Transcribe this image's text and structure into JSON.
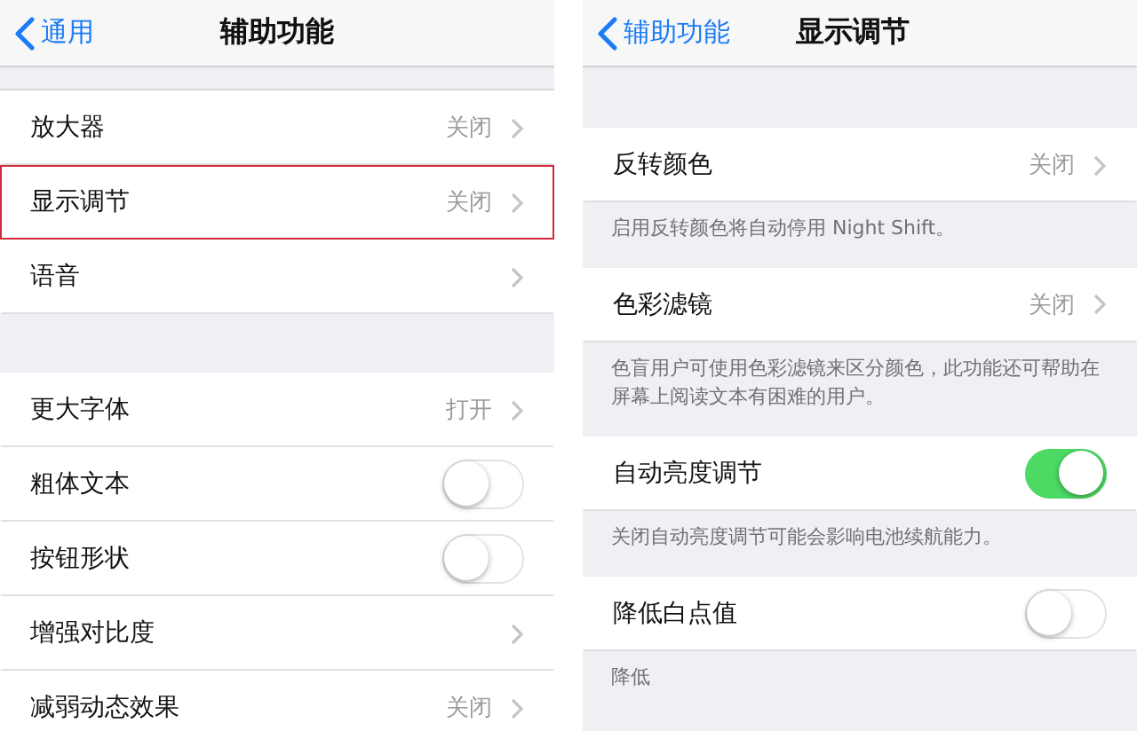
{
  "panels": [
    {
      "back": "通用",
      "title": "辅助功能",
      "groups": [
        {
          "rows": [
            {
              "kind": "disclosure",
              "label": "放大器",
              "value": "关闭",
              "highlighted": false
            },
            {
              "kind": "disclosure",
              "label": "显示调节",
              "value": "关闭",
              "highlighted": true
            },
            {
              "kind": "disclosure",
              "label": "语音",
              "highlighted": false
            }
          ]
        },
        {
          "rows": [
            {
              "kind": "disclosure",
              "label": "更大字体",
              "value": "打开",
              "highlighted": false
            },
            {
              "kind": "toggle",
              "label": "粗体文本",
              "on": false,
              "highlighted": false
            },
            {
              "kind": "toggle",
              "label": "按钮形状",
              "on": false,
              "highlighted": false
            },
            {
              "kind": "disclosure",
              "label": "增强对比度",
              "highlighted": false
            },
            {
              "kind": "disclosure",
              "label": "减弱动态效果",
              "value": "关闭",
              "highlighted": false
            }
          ]
        }
      ]
    },
    {
      "back": "辅助功能",
      "title": "显示调节",
      "groups": [
        {
          "rows": [
            {
              "kind": "disclosure",
              "label": "反转颜色",
              "value": "关闭",
              "highlighted": false
            }
          ],
          "footer": "启用反转颜色将自动停用 Night Shift。"
        },
        {
          "rows": [
            {
              "kind": "disclosure",
              "label": "色彩滤镜",
              "value": "关闭",
              "highlighted": false
            }
          ],
          "footer": "色盲用户可使用色彩滤镜来区分颜色，此功能还可帮助在屏幕上阅读文本有困难的用户。"
        },
        {
          "rows": [
            {
              "kind": "toggle",
              "label": "自动亮度调节",
              "on": true,
              "highlighted": false
            }
          ],
          "footer": "关闭自动亮度调节可能会影响电池续航能力。"
        },
        {
          "rows": [
            {
              "kind": "toggle",
              "label": "降低白点值",
              "on": false,
              "highlighted": false
            }
          ],
          "footer": "降低"
        }
      ]
    }
  ]
}
